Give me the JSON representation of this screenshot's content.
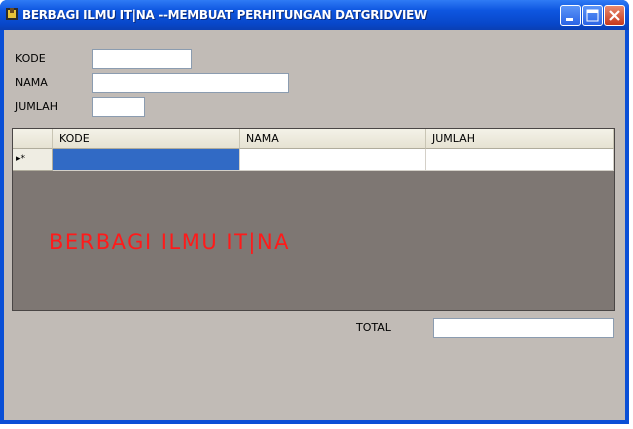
{
  "window": {
    "title": "BERBAGI ILMU IT|NA --MEMBUAT PERHITUNGAN DATGRIDVIEW"
  },
  "form": {
    "kode_label": "KODE",
    "kode_value": "",
    "nama_label": "NAMA",
    "nama_value": "",
    "jumlah_label": "JUMLAH",
    "jumlah_value": "",
    "total_label": "TOTAL",
    "total_value": ""
  },
  "grid": {
    "columns": [
      "KODE",
      "NAMA",
      "JUMLAH"
    ],
    "new_row_marker": "▸*",
    "watermark": "BERBAGI ILMU IT|NA"
  },
  "colors": {
    "titlebar": "#0e56e0",
    "client_bg": "#c1bbb6",
    "grid_bg": "#7e7773",
    "selection": "#316ac5",
    "watermark": "#ff1a1a"
  }
}
